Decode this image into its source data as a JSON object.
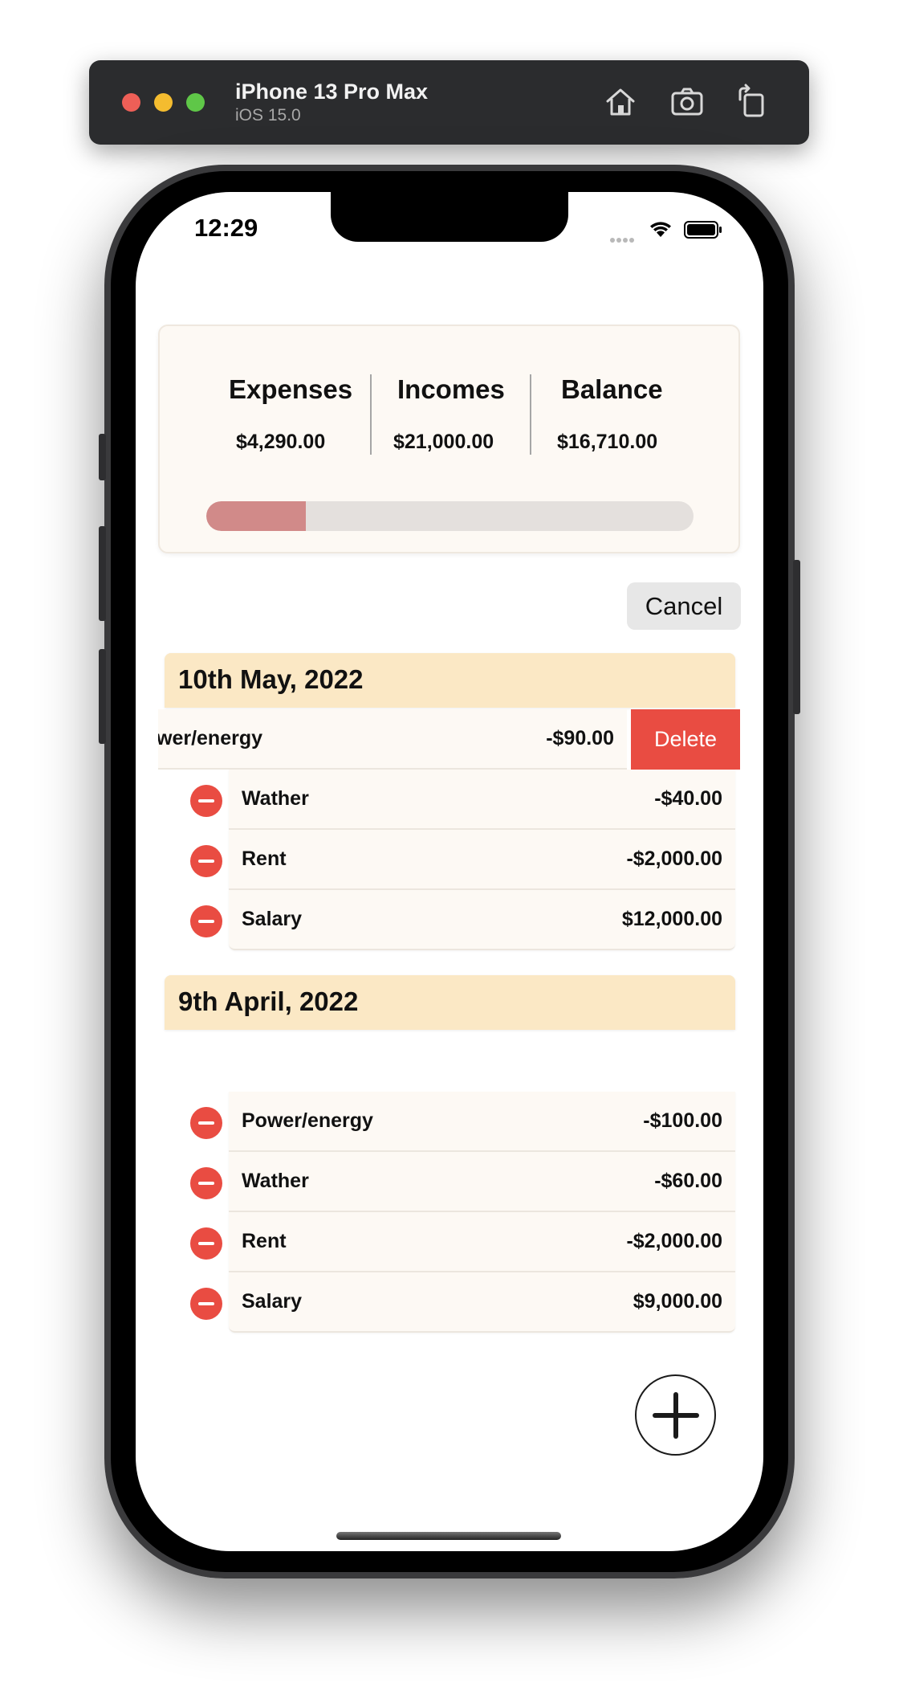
{
  "simulator": {
    "device_name": "iPhone 13 Pro Max",
    "os_version": "iOS 15.0",
    "buttons": [
      "home-icon",
      "screenshot-icon",
      "rotate-icon"
    ]
  },
  "status_bar": {
    "time": "12:29"
  },
  "summary": {
    "expenses_label": "Expenses",
    "expenses_value": "$4,290.00",
    "incomes_label": "Incomes",
    "incomes_value": "$21,000.00",
    "balance_label": "Balance",
    "balance_value": "$16,710.00",
    "progress_fraction": 0.2043,
    "progress_color": "#d18a89"
  },
  "cancel_label": "Cancel",
  "delete_label": "Delete",
  "sections": [
    {
      "date": "10th May, 2022",
      "swiped_row": {
        "name": "wer/energy",
        "amount": "-$90.00"
      },
      "rows": [
        {
          "name": "Wather",
          "amount": "-$40.00"
        },
        {
          "name": "Rent",
          "amount": "-$2,000.00"
        },
        {
          "name": "Salary",
          "amount": "$12,000.00"
        }
      ]
    },
    {
      "date": "9th April, 2022",
      "rows": [
        {
          "name": "Power/energy",
          "amount": "-$100.00"
        },
        {
          "name": "Wather",
          "amount": "-$60.00"
        },
        {
          "name": "Rent",
          "amount": "-$2,000.00"
        },
        {
          "name": "Salary",
          "amount": "$9,000.00"
        }
      ]
    }
  ],
  "colors": {
    "section_header": "#fbe8c5",
    "row_background": "#fdf9f4",
    "delete_red": "#e94c42"
  }
}
